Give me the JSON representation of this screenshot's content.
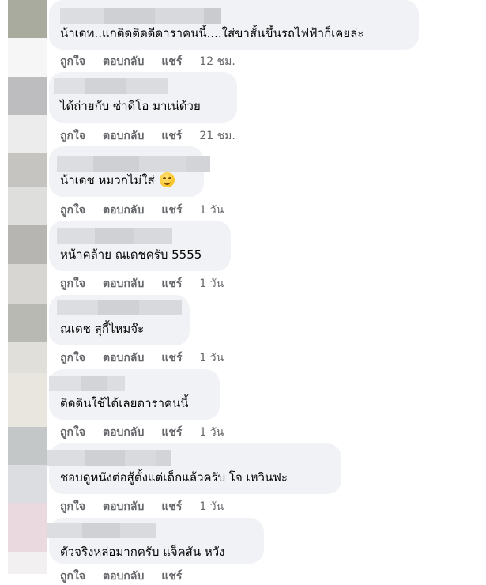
{
  "comments": [
    {
      "text": "น้าเดท..แกติดติดดีดาราคนนี้....ใส่ขาสั้นขึ้นรถไฟฟ้าก็เคยล่ะ",
      "like": "ถูกใจ",
      "reply": "ตอบกลับ",
      "share": "แชร์",
      "time": "12 ชม."
    },
    {
      "text": "ได้ถ่ายกับ ซ่าดิโอ มาเน่ด้วย",
      "like": "ถูกใจ",
      "reply": "ตอบกลับ",
      "share": "แชร์",
      "time": "21 ชม."
    },
    {
      "text": "น้าเดช หมวกไม่ใส่",
      "emoji": "smiling-face-emoji",
      "like": "ถูกใจ",
      "reply": "ตอบกลับ",
      "share": "แชร์",
      "time": "1 วัน"
    },
    {
      "text": "หน้าคล้าย ณเดชครับ 5555",
      "like": "ถูกใจ",
      "reply": "ตอบกลับ",
      "share": "แชร์",
      "time": "1 วัน"
    },
    {
      "text": "ณเดช สุกี้ไหมจ๊ะ",
      "like": "ถูกใจ",
      "reply": "ตอบกลับ",
      "share": "แชร์",
      "time": "1 วัน"
    },
    {
      "text": "ติดดินใช้ได้เลยดาราคนนี้",
      "like": "ถูกใจ",
      "reply": "ตอบกลับ",
      "share": "แชร์",
      "time": "1 วัน"
    },
    {
      "text": "ชอบดูหนังต่อสู้ตั้งแต่เด็กแล้วครับ โจ เหวินฟะ",
      "like": "ถูกใจ",
      "reply": "ตอบกลับ",
      "share": "แชร์",
      "time": "1 วัน"
    },
    {
      "text": "ตัวจริงหล่อมากครับ แจ็คสัน หวัง",
      "like": "ถูกใจ",
      "reply": "ตอบกลับ",
      "share": "แชร์",
      "time": ""
    }
  ]
}
